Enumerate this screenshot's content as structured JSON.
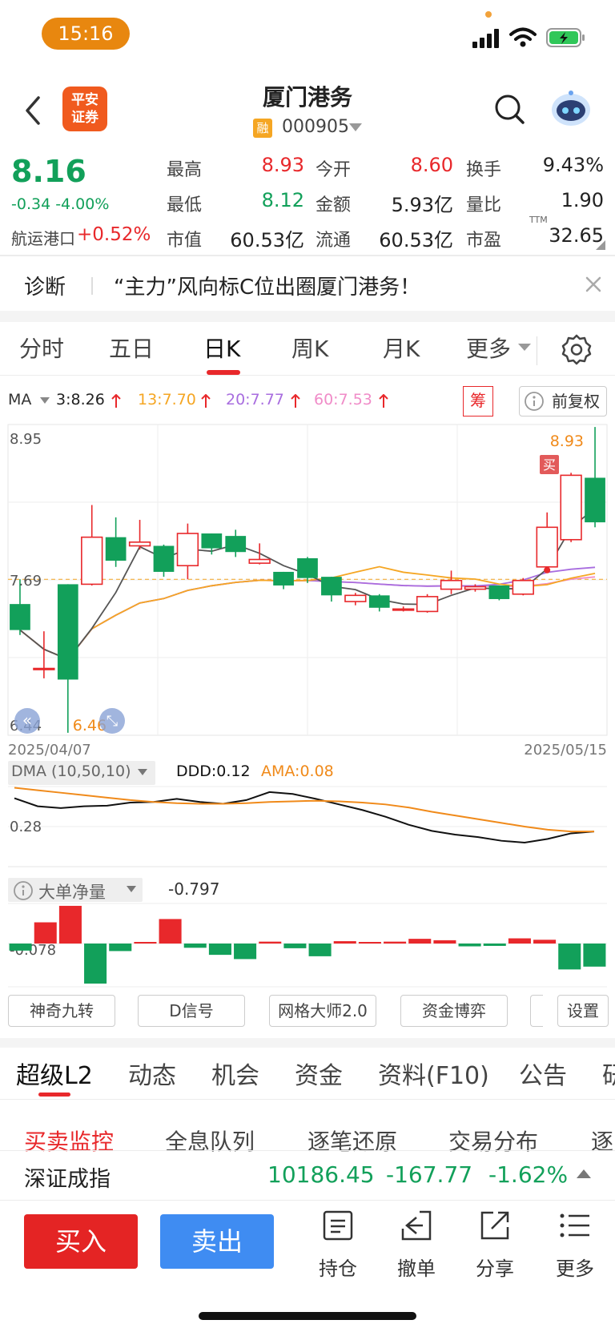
{
  "status_bar": {
    "time": "15:16"
  },
  "header": {
    "broker_logo": "平安\n证券",
    "stock_name": "厦门港务",
    "rong_badge": "融",
    "stock_code": "000905"
  },
  "quote": {
    "price": "8.16",
    "change": "-0.34 -4.00%",
    "sector_name": "航运港口",
    "sector_change": "+0.52%",
    "fields": [
      {
        "label": "最高",
        "value": "8.93",
        "color": "red"
      },
      {
        "label": "今开",
        "value": "8.60",
        "color": "red"
      },
      {
        "label": "换手",
        "value": "9.43%",
        "color": "black"
      },
      {
        "label": "最低",
        "value": "8.12",
        "color": "green"
      },
      {
        "label": "金额",
        "value": "5.93亿",
        "color": "black"
      },
      {
        "label": "量比",
        "value": "1.90",
        "color": "black"
      },
      {
        "label": "市值",
        "value": "60.53亿",
        "color": "black"
      },
      {
        "label": "流通",
        "value": "60.53亿",
        "color": "black"
      },
      {
        "label": "市盈",
        "value": "32.65",
        "color": "black"
      }
    ],
    "pe_suffix": "TTM"
  },
  "diagnosis": {
    "label": "诊断",
    "text": "“主力”风向标C位出圈厦门港务！"
  },
  "period_tabs": [
    "分时",
    "五日",
    "日K",
    "周K",
    "月K",
    "更多"
  ],
  "active_period": "日K",
  "ma_legend": {
    "label": "MA",
    "items": [
      {
        "text": "3:8.26",
        "color": "#555555"
      },
      {
        "text": "13:7.70",
        "color": "#f5a623"
      },
      {
        "text": "20:7.77",
        "color": "#a86ddf"
      },
      {
        "text": "60:7.53",
        "color": "#f08cc8"
      }
    ],
    "chip": "筹",
    "adjust": "前复权"
  },
  "colors": {
    "up": "#e8282b",
    "down": "#12a05a",
    "accent": "#e8282b",
    "sell_blue": "#3f8cf2"
  },
  "chart_data": [
    {
      "type": "candlestick",
      "title": "",
      "ylim": [
        6.44,
        8.95
      ],
      "y_axis_labels": [
        "8.95",
        "7.69",
        "6.44"
      ],
      "high_label": "8.93",
      "low_label": "6.46",
      "buy_marker": "买",
      "start_date": "2025/04/07",
      "end_date": "2025/05/15",
      "candles": [
        {
          "o": 7.5,
          "h": 7.7,
          "l": 7.25,
          "c": 7.29
        },
        {
          "o": 6.98,
          "h": 7.28,
          "l": 6.9,
          "c": 6.98
        },
        {
          "o": 7.66,
          "h": 7.66,
          "l": 6.46,
          "c": 6.89
        },
        {
          "o": 7.66,
          "h": 8.3,
          "l": 7.65,
          "c": 8.04
        },
        {
          "o": 8.04,
          "h": 8.2,
          "l": 7.8,
          "c": 7.85
        },
        {
          "o": 7.97,
          "h": 8.18,
          "l": 7.94,
          "c": 8.0
        },
        {
          "o": 7.97,
          "h": 7.98,
          "l": 7.72,
          "c": 7.76
        },
        {
          "o": 7.81,
          "h": 8.15,
          "l": 7.7,
          "c": 8.07
        },
        {
          "o": 8.07,
          "h": 8.07,
          "l": 7.9,
          "c": 7.95
        },
        {
          "o": 8.05,
          "h": 8.1,
          "l": 7.88,
          "c": 7.92
        },
        {
          "o": 7.83,
          "h": 7.99,
          "l": 7.82,
          "c": 7.86
        },
        {
          "o": 7.76,
          "h": 7.76,
          "l": 7.62,
          "c": 7.65
        },
        {
          "o": 7.87,
          "h": 7.88,
          "l": 7.67,
          "c": 7.71
        },
        {
          "o": 7.72,
          "h": 7.72,
          "l": 7.52,
          "c": 7.57
        },
        {
          "o": 7.52,
          "h": 7.59,
          "l": 7.49,
          "c": 7.57
        },
        {
          "o": 7.57,
          "h": 7.58,
          "l": 7.44,
          "c": 7.47
        },
        {
          "o": 7.45,
          "h": 7.48,
          "l": 7.44,
          "c": 7.46
        },
        {
          "o": 7.44,
          "h": 7.58,
          "l": 7.43,
          "c": 7.56
        },
        {
          "o": 7.62,
          "h": 7.77,
          "l": 7.58,
          "c": 7.69
        },
        {
          "o": 7.62,
          "h": 7.66,
          "l": 7.6,
          "c": 7.64
        },
        {
          "o": 7.65,
          "h": 7.65,
          "l": 7.53,
          "c": 7.54
        },
        {
          "o": 7.58,
          "h": 7.71,
          "l": 7.57,
          "c": 7.69
        },
        {
          "o": 7.8,
          "h": 8.24,
          "l": 7.79,
          "c": 8.12
        },
        {
          "o": 8.02,
          "h": 8.56,
          "l": 8.0,
          "c": 8.54
        },
        {
          "o": 8.52,
          "h": 8.93,
          "l": 8.12,
          "c": 8.16
        }
      ]
    },
    {
      "type": "line",
      "title": "DMA (10,50,10)",
      "ylim": [
        -0.55,
        0.75
      ],
      "y_axis_labels": [
        "0.28"
      ],
      "series": [
        {
          "name": "DDD:0.12",
          "values": [
            0.56,
            0.43,
            0.4,
            0.43,
            0.44,
            0.49,
            0.5,
            0.55,
            0.5,
            0.47,
            0.53,
            0.66,
            0.63,
            0.55,
            0.46,
            0.37,
            0.26,
            0.13,
            0.03,
            -0.03,
            -0.07,
            -0.13,
            -0.16,
            -0.1,
            -0.01,
            0.02
          ]
        },
        {
          "name": "AMA:0.08",
          "values": [
            0.73,
            0.69,
            0.65,
            0.61,
            0.57,
            0.53,
            0.5,
            0.48,
            0.47,
            0.47,
            0.48,
            0.5,
            0.51,
            0.52,
            0.51,
            0.49,
            0.46,
            0.41,
            0.34,
            0.28,
            0.22,
            0.16,
            0.1,
            0.05,
            0.02,
            0.02
          ]
        }
      ]
    },
    {
      "type": "bar",
      "title": "大单净量",
      "value_label": "-0.797",
      "ylim": [
        -0.85,
        0.85
      ],
      "y_axis_labels": [
        "-0.078"
      ],
      "values": [
        -0.15,
        0.45,
        0.8,
        -0.85,
        -0.16,
        0.03,
        0.52,
        -0.09,
        -0.24,
        -0.33,
        0.04,
        -0.1,
        -0.27,
        0.05,
        0.02,
        0.04,
        0.1,
        0.07,
        -0.06,
        -0.05,
        0.11,
        0.08,
        -0.55,
        -0.49
      ]
    }
  ],
  "strategy_buttons": [
    "神奇九转",
    "D信号",
    "网格大师2.0",
    "资金博弈",
    "",
    "设置"
  ],
  "bottom_tabs": [
    "超级L2",
    "动态",
    "机会",
    "资金",
    "资料(F10)",
    "公告",
    "研"
  ],
  "sub_tabs": [
    "买卖监控",
    "全息队列",
    "逐笔还原",
    "交易分布",
    "逐"
  ],
  "index": {
    "name": "深证成指",
    "value": "10186.45",
    "change": "-167.77",
    "pct": "-1.62%"
  },
  "actions": {
    "buy": "买入",
    "sell": "卖出",
    "items": [
      "持仓",
      "撤单",
      "分享",
      "更多"
    ]
  }
}
